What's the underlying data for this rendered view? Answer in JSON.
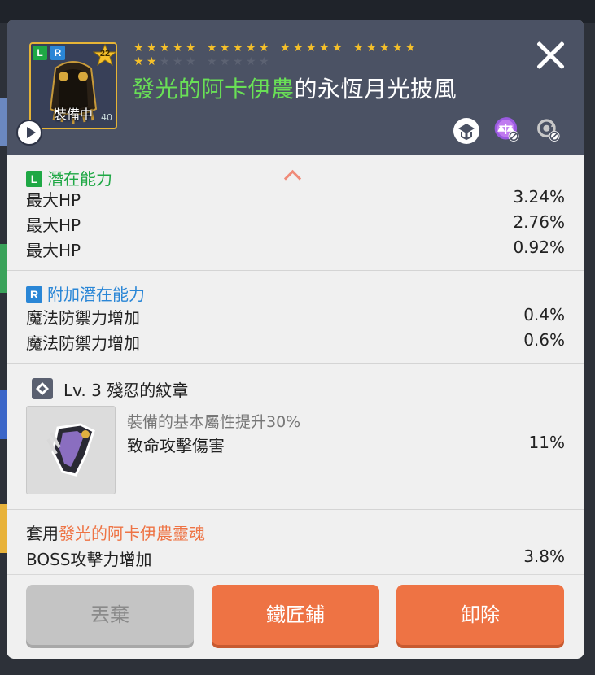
{
  "item": {
    "badges": [
      "L",
      "R"
    ],
    "star_force_level": "22",
    "equipped_label": "裝備中",
    "small_number": "40",
    "stars_row1_filled": 20,
    "stars_row2_filled": 2,
    "stars_row2_total": 10,
    "title_prefix": "發光的阿卡伊農",
    "title_suffix": "的永恆月光披風"
  },
  "header_icons": [
    "transfer-icon",
    "scale-icon",
    "refresh-locked-icon"
  ],
  "potential": {
    "tag": "L",
    "label": "潛在能力",
    "stats": [
      {
        "name": "最大HP",
        "value": "3.24%"
      },
      {
        "name": "最大HP",
        "value": "2.76%"
      },
      {
        "name": "最大HP",
        "value": "0.92%"
      }
    ]
  },
  "additional_potential": {
    "tag": "R",
    "label": "附加潛在能力",
    "stats": [
      {
        "name": "魔法防禦力增加",
        "value": "0.4%"
      },
      {
        "name": "魔法防禦力增加",
        "value": "0.6%"
      }
    ]
  },
  "emblem": {
    "title": "Lv. 3 殘忍的紋章",
    "desc": "裝備的基本屬性提升30%",
    "stat_name": "致命攻擊傷害",
    "stat_value": "11%"
  },
  "soul": {
    "prefix": "套用",
    "name": "發光的阿卡伊農靈魂",
    "stat_name": "BOSS攻擊力增加",
    "stat_value": "3.8%"
  },
  "buttons": {
    "discard": "丟棄",
    "blacksmith": "鐵匠鋪",
    "unequip": "卸除"
  },
  "colors": {
    "legendary_green": "#1fa845",
    "rare_blue": "#2a86d6",
    "title_green": "#69e056",
    "soul_orange": "#ee7344",
    "button_orange": "#ee7344",
    "star_gold": "#f5c02a"
  }
}
